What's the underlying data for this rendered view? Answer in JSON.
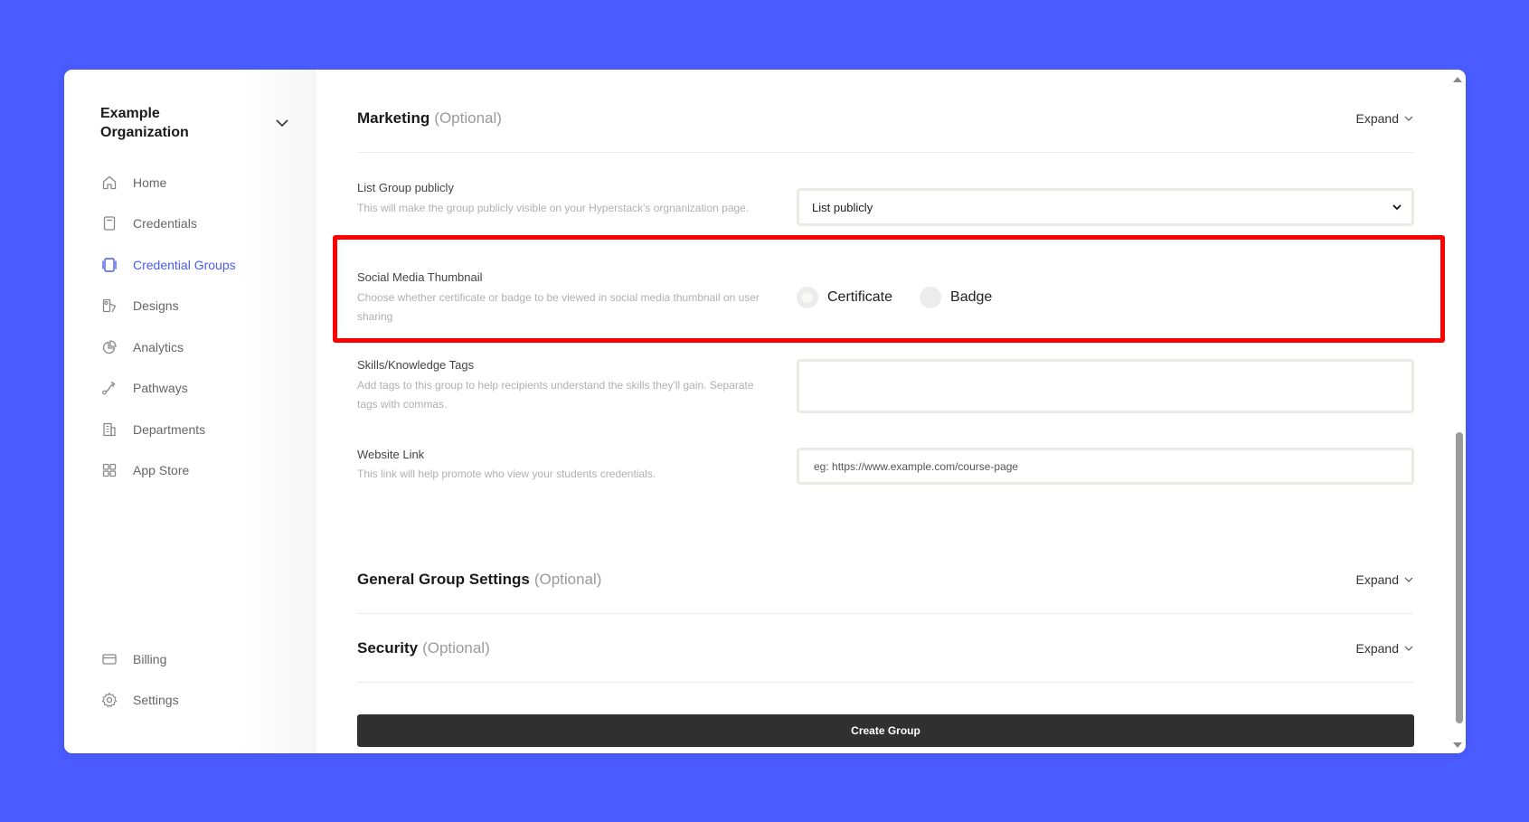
{
  "sidebar": {
    "org_name": "Example Organization",
    "items": [
      {
        "label": "Home",
        "icon": "home-icon"
      },
      {
        "label": "Credentials",
        "icon": "credential-icon"
      },
      {
        "label": "Credential Groups",
        "icon": "credential-groups-icon",
        "active": true
      },
      {
        "label": "Designs",
        "icon": "designs-icon"
      },
      {
        "label": "Analytics",
        "icon": "analytics-icon"
      },
      {
        "label": "Pathways",
        "icon": "pathways-icon"
      },
      {
        "label": "Departments",
        "icon": "departments-icon"
      },
      {
        "label": "App Store",
        "icon": "app-store-icon"
      }
    ],
    "bottom_items": [
      {
        "label": "Billing",
        "icon": "billing-icon"
      },
      {
        "label": "Settings",
        "icon": "gear-icon"
      }
    ]
  },
  "sections": {
    "marketing": {
      "title": "Marketing",
      "optional": "(Optional)",
      "expand": "Expand"
    },
    "general": {
      "title": "General Group Settings",
      "optional": "(Optional)",
      "expand": "Expand"
    },
    "security": {
      "title": "Security",
      "optional": "(Optional)",
      "expand": "Expand"
    }
  },
  "fields": {
    "list_public": {
      "label": "List Group publicly",
      "desc": "This will make the group publicly visible on your Hyperstack's orgnanization page.",
      "value": "List publicly"
    },
    "social_thumb": {
      "label": "Social Media Thumbnail",
      "desc": "Choose whether certificate or badge to be viewed in social media thumbnail on user sharing",
      "options": [
        "Certificate",
        "Badge"
      ],
      "selected": "Certificate"
    },
    "skills": {
      "label": "Skills/Knowledge Tags",
      "desc": "Add tags to this group to help recipients understand the skills they'll gain. Separate tags with commas.",
      "value": ""
    },
    "website": {
      "label": "Website Link",
      "desc": "This link will help promote who view your students credentials.",
      "placeholder": "eg: https://www.example.com/course-page"
    }
  },
  "create_button": "Create Group",
  "colors": {
    "background": "#4a5cff",
    "accent": "#4a5cf0",
    "highlight": "#ff0000",
    "button": "#303030"
  }
}
